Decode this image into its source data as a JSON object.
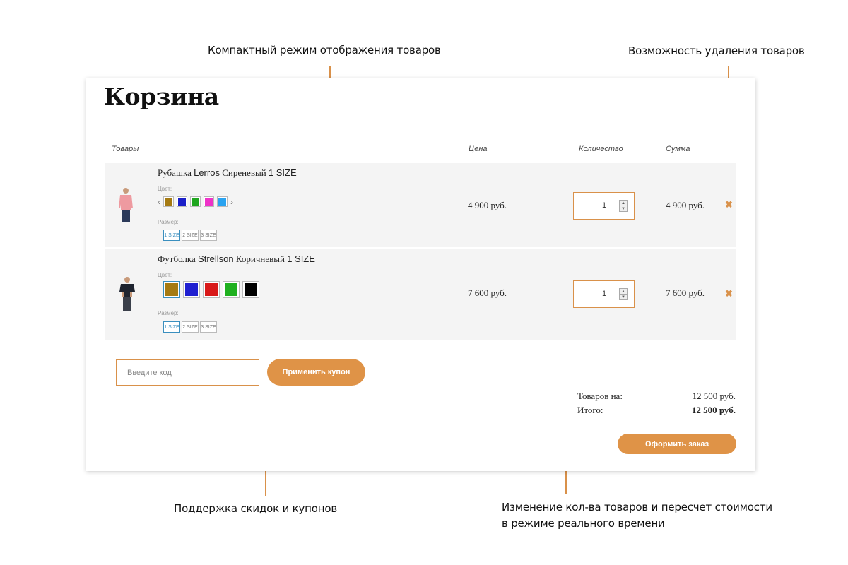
{
  "annotations": {
    "compact": "Компактный режим отображения товаров",
    "delete": "Возможность удаления товаров",
    "coupons": "Поддержка скидок и купонов",
    "recalc_line1": "Изменение кол-ва товаров и пересчет стоимости",
    "recalc_line2": "в режиме реального времени"
  },
  "cart": {
    "title": "Корзина",
    "columns": {
      "products": "Товары",
      "price": "Цена",
      "quantity": "Количество",
      "sum": "Сумма"
    },
    "color_label": "Цвет:",
    "size_label": "Размер:",
    "sizes": [
      "1 SIZE",
      "2 SIZE",
      "3 SIZE"
    ],
    "items": [
      {
        "name_prefix": "Рубашка",
        "brand": "Lerros",
        "name_suffix": "Сиреневый",
        "size_suffix": "1 SIZE",
        "colors": [
          "#a57a12",
          "#1a1fc8",
          "#1fa61f",
          "#ee32c8",
          "#2aa3f0"
        ],
        "selected_size": "1 SIZE",
        "price": "4 900 руб.",
        "quantity": "1",
        "sum": "4 900 руб.",
        "image": "pink-shirt-model"
      },
      {
        "name_prefix": "Футболка",
        "brand": "Strellson",
        "name_suffix": "Коричневый",
        "size_suffix": "1 SIZE",
        "colors": [
          "#a57a12",
          "#1f1fd0",
          "#d81818",
          "#1fb01f",
          "#000000"
        ],
        "selected_size": "1 SIZE",
        "price": "7 600 руб.",
        "quantity": "1",
        "sum": "7 600 руб.",
        "image": "dark-tshirt-model"
      }
    ],
    "coupon": {
      "placeholder": "Введите код",
      "apply_label": "Применить купон"
    },
    "totals": {
      "goods_label": "Товаров на:",
      "goods_value": "12 500 руб.",
      "total_label": "Итого:",
      "total_value": "12 500 руб."
    },
    "checkout_label": "Оформить заказ"
  },
  "colors": {
    "accent": "#df9347",
    "row_bg": "#f4f4f4",
    "selected_border": "#3a8fbf"
  },
  "icons": {
    "remove": "close-icon",
    "spinner_up": "chevron-up-icon",
    "spinner_down": "chevron-down-icon",
    "swatch_prev": "chevron-left-icon",
    "swatch_next": "chevron-right-icon"
  }
}
